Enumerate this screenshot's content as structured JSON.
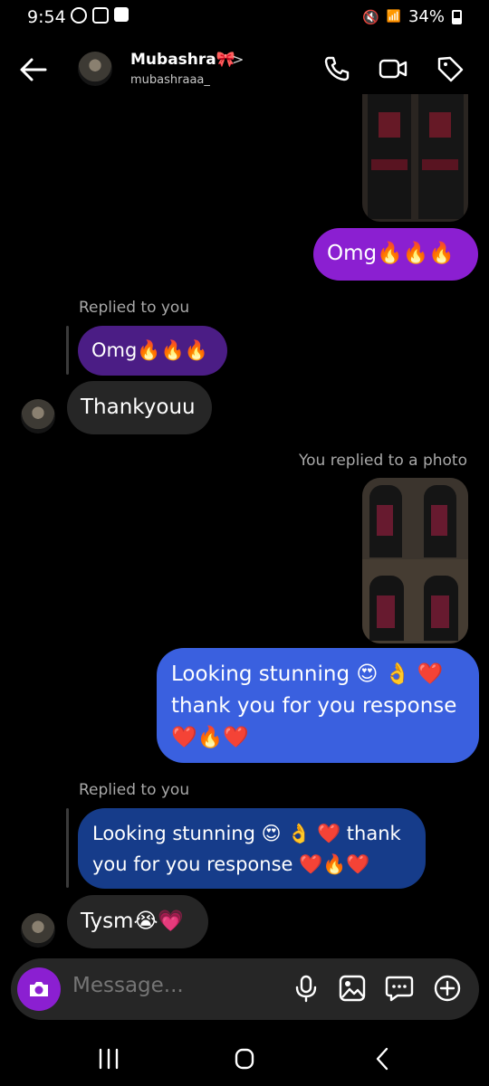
{
  "status": {
    "time": "9:54",
    "battery": "34%"
  },
  "header": {
    "name": "Mubashra🎀",
    "username": "mubashraaa_",
    "chevron": ">"
  },
  "messages": {
    "sent_omg": "Omg🔥🔥🔥",
    "reply_label_1": "Replied to you",
    "quoted_omg": "Omg🔥🔥🔥",
    "thanks": "Thankyouu",
    "photo_reply_label": "You replied to a photo",
    "stunning_line1": "Looking stunning 😍 👌 ❤️",
    "stunning_line2": "thank you for you response",
    "stunning_line3": "❤️🔥❤️",
    "reply_label_2": "Replied to you",
    "quoted_line1": "Looking stunning 😍 👌 ❤️ thank",
    "quoted_line2": "you for you response ❤️🔥❤️",
    "tysm": "Tysm😭💗"
  },
  "composer": {
    "placeholder": "Message..."
  }
}
